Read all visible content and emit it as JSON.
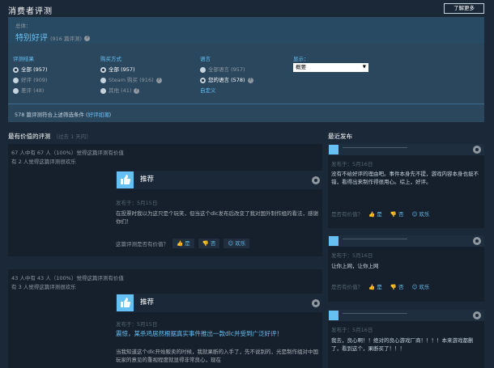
{
  "header": {
    "title": "消费者评测",
    "learn_more": "了解更多"
  },
  "overall": {
    "label": "总体：",
    "value": "特别好评",
    "count": "(916 篇评测)",
    "help": "?"
  },
  "filters": {
    "rating": {
      "title": "评测结果",
      "options": [
        {
          "label": "全部",
          "count": "(957)",
          "selected": true
        },
        {
          "label": "好评",
          "count": "(909)"
        },
        {
          "label": "差评",
          "count": "(48)"
        }
      ]
    },
    "purchase": {
      "title": "购买方式",
      "options": [
        {
          "label": "全部",
          "count": "(957)",
          "selected": true
        },
        {
          "label": "Steam 购买",
          "count": "(916)",
          "help": "?"
        },
        {
          "label": "其他",
          "count": "(41)",
          "help": "?"
        }
      ]
    },
    "language": {
      "title": "语言",
      "options": [
        {
          "label": "全部语言",
          "count": "(957)"
        },
        {
          "label": "您的语言",
          "count": "(578)",
          "help": "?",
          "selected": true
        }
      ],
      "custom": "自定义"
    },
    "display": {
      "title": "显示：",
      "selected": "概要",
      "arrow": "▼"
    }
  },
  "match": {
    "text": "578 篇评测符合上述筛选条件 (",
    "link": "好评如潮",
    "suffix": ")"
  },
  "most_helpful": {
    "title": "最有价值的评测",
    "sub": "（过去 1 天内）"
  },
  "recent": {
    "title": "最近发布"
  },
  "reviews": [
    {
      "helpful": "67 人中有 67 人（100%）觉得这篇评测有价值",
      "funny": "有 2 人觉得这篇评测很欢乐",
      "rec": "推荐",
      "posted": "发布于：5月15日",
      "text": "在投票时我以为这只是个玩笑，但当这个dlc发布后改变了我对国外制作组的看法，感谢你们！",
      "vote_q": "这篇评测是否有价值？",
      "yes": "是",
      "no": "否",
      "fun": "欢乐"
    },
    {
      "helpful": "43 人中有 43 人（100%）觉得这篇评测有价值",
      "funny": "有 3 人觉得这篇评测很欢乐",
      "rec": "推荐",
      "posted": "发布于：5月15日",
      "highlight": "震惊，某杀鸡居然根据真实事件推出一款dlc并受到广泛好评！",
      "text": "当我知道这个dlc开始贩卖的时候，我就果断的入手了，先不说别的，光是制作组对中国玩家的意见的重视程度就显得非常良心，现在"
    }
  ],
  "recent_reviews": [
    {
      "posted": "发布于：5月16日",
      "text": "没有不给好评的理由吧。事件本身先不提，游戏内容本身也挺不错，看得出来制作得很用心。综上，好评。",
      "vote_q": "是否有价值？",
      "yes": "是",
      "no": "否",
      "fun": "欢乐"
    },
    {
      "posted": "发布于：5月16日",
      "text": "让你上网，让你上网",
      "vote_q": "是否有价值？",
      "yes": "是",
      "no": "否",
      "fun": "欢乐"
    },
    {
      "posted": "发布于：5月16日",
      "text": "我去，良心啊！！绝对的良心游戏厂商！！！！本来游戏都删了，看到这个，果断买了！！！"
    }
  ]
}
